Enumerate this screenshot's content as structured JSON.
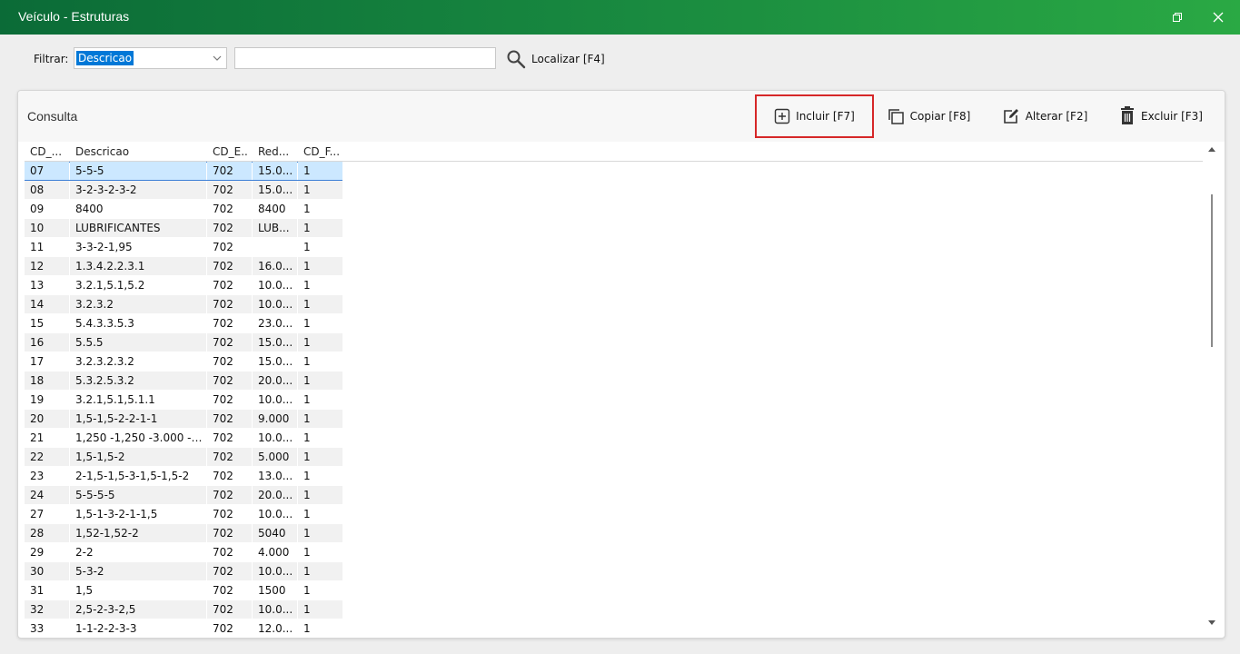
{
  "window": {
    "title": "Veículo - Estruturas"
  },
  "filter": {
    "label": "Filtrar:",
    "selected_field": "Descricao",
    "search_value": "",
    "locate_label": "Localizar [F4]"
  },
  "panel": {
    "title": "Consulta",
    "toolbar": {
      "incluir": "Incluir [F7]",
      "copiar": "Copiar [F8]",
      "alterar": "Alterar [F2]",
      "excluir": "Excluir [F3]"
    }
  },
  "grid": {
    "columns": [
      "CD_...",
      "Descricao",
      "CD_E...",
      "Red...",
      "CD_F..."
    ],
    "rows": [
      [
        "07",
        "5-5-5",
        "702",
        "15.0...",
        "1"
      ],
      [
        "08",
        "3-2-3-2-3-2",
        "702",
        "15.0...",
        "1"
      ],
      [
        "09",
        "8400",
        "702",
        "8400",
        "1"
      ],
      [
        "10",
        "LUBRIFICANTES",
        "702",
        "LUB...",
        "1"
      ],
      [
        "11",
        "3-3-2-1,95",
        "702",
        "",
        "1"
      ],
      [
        "12",
        "1.3.4.2.2.3.1",
        "702",
        "16.0...",
        "1"
      ],
      [
        "13",
        "3.2.1,5.1,5.2",
        "702",
        "10.0...",
        "1"
      ],
      [
        "14",
        "3.2.3.2",
        "702",
        "10.0...",
        "1"
      ],
      [
        "15",
        "5.4.3.3.5.3",
        "702",
        "23.0...",
        "1"
      ],
      [
        "16",
        "5.5.5",
        "702",
        "15.0...",
        "1"
      ],
      [
        "17",
        "3.2.3.2.3.2",
        "702",
        "15.0...",
        "1"
      ],
      [
        "18",
        "5.3.2.5.3.2",
        "702",
        "20.0...",
        "1"
      ],
      [
        "19",
        "3.2.1,5.1,5.1.1",
        "702",
        "10.0...",
        "1"
      ],
      [
        "20",
        "1,5-1,5-2-2-1-1",
        "702",
        "9.000",
        "1"
      ],
      [
        "21",
        "1,250 -1,250 -3.000 -2...",
        "702",
        "10.0...",
        "1"
      ],
      [
        "22",
        "1,5-1,5-2",
        "702",
        "5.000",
        "1"
      ],
      [
        "23",
        "2-1,5-1,5-3-1,5-1,5-2",
        "702",
        "13.0...",
        "1"
      ],
      [
        "24",
        "5-5-5-5",
        "702",
        "20.0...",
        "1"
      ],
      [
        "27",
        "1,5-1-3-2-1-1,5",
        "702",
        "10.0...",
        "1"
      ],
      [
        "28",
        "1,52-1,52-2",
        "702",
        "5040",
        "1"
      ],
      [
        "29",
        "2-2",
        "702",
        "4.000",
        "1"
      ],
      [
        "30",
        "5-3-2",
        "702",
        "10.0...",
        "1"
      ],
      [
        "31",
        "1,5",
        "702",
        "1500",
        "1"
      ],
      [
        "32",
        "2,5-2-3-2,5",
        "702",
        "10.0...",
        "1"
      ],
      [
        "33",
        "1-1-2-2-3-3",
        "702",
        "12.0...",
        "1"
      ]
    ],
    "selected_row": 0
  },
  "icons": {
    "restore": "restore-icon",
    "close": "close-icon",
    "search": "search-icon",
    "add": "plus-square-icon",
    "copy": "copy-icon",
    "edit": "edit-icon",
    "delete": "trash-icon"
  },
  "colors": {
    "titlebar_start": "#0b6b37",
    "titlebar_end": "#2aa944",
    "selection": "#cce8ff",
    "highlight_border": "#d62728"
  }
}
